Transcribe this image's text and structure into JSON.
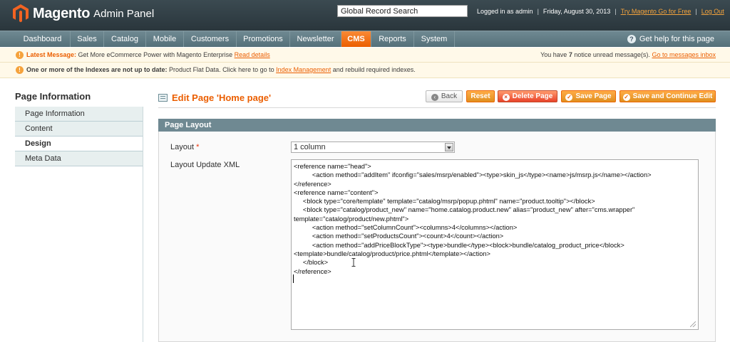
{
  "header": {
    "logo_text": "Magento",
    "logo_sub": "Admin Panel",
    "search_value": "Global Record Search",
    "logged_in": "Logged in as admin",
    "date": "Friday, August 30, 2013",
    "try_link": "Try Magento Go for Free",
    "logout": "Log Out"
  },
  "nav": {
    "items": [
      "Dashboard",
      "Sales",
      "Catalog",
      "Mobile",
      "Customers",
      "Promotions",
      "Newsletter",
      "CMS",
      "Reports",
      "System"
    ],
    "active": "CMS",
    "help": "Get help for this page"
  },
  "messages": {
    "latest_label": "Latest Message:",
    "latest_text": "Get More eCommerce Power with Magento Enterprise",
    "latest_link": "Read details",
    "notice_prefix": "You have",
    "notice_count": "7",
    "notice_suffix": "notice unread message(s).",
    "notice_link": "Go to messages inbox",
    "index_bold": "One or more of the Indexes are not up to date:",
    "index_text": "Product Flat Data. Click here to go to",
    "index_link": "Index Management",
    "index_tail": "and rebuild required indexes."
  },
  "sidebar": {
    "title": "Page Information",
    "items": [
      "Page Information",
      "Content",
      "Design",
      "Meta Data"
    ],
    "active": "Design"
  },
  "page": {
    "title": "Edit Page 'Home page'",
    "buttons": {
      "back": "Back",
      "reset": "Reset",
      "delete": "Delete Page",
      "save": "Save Page",
      "save_continue": "Save and Continue Edit"
    }
  },
  "section": {
    "title": "Page Layout",
    "layout_label": "Layout",
    "layout_required": "*",
    "layout_value": "1 column",
    "xml_label": "Layout Update XML",
    "xml_lines": [
      "<reference name=\"head\">",
      "          <action method=\"addItem\" ifconfig=\"sales/msrp/enabled\"><type>skin_js</type><name>js/msrp.js</name></action>",
      "</reference>",
      "<reference name=\"content\">",
      "     <block type=\"core/template\" template=\"catalog/msrp/popup.phtml\" name=\"product.tooltip\"></block>",
      "     <block type=\"catalog/product_new\" name=\"home.catalog.product.new\" alias=\"product_new\" after=\"cms.wrapper\"",
      "template=\"catalog/product/new.phtml\">",
      "          <action method=\"setColumnCount\"><columns>4</columns></action>",
      "          <action method=\"setProductsCount\"><count>4</count></action>",
      "          <action method=\"addPriceBlockType\"><type>bundle</type><block>bundle/catalog_product_price</block>",
      "<template>bundle/catalog/product/price.phtml</template></action>",
      "     </block>",
      "</reference>"
    ]
  },
  "colors": {
    "accent": "#eb5e00",
    "header_bg": "#2f3c42",
    "nav_bg": "#6f8992"
  }
}
